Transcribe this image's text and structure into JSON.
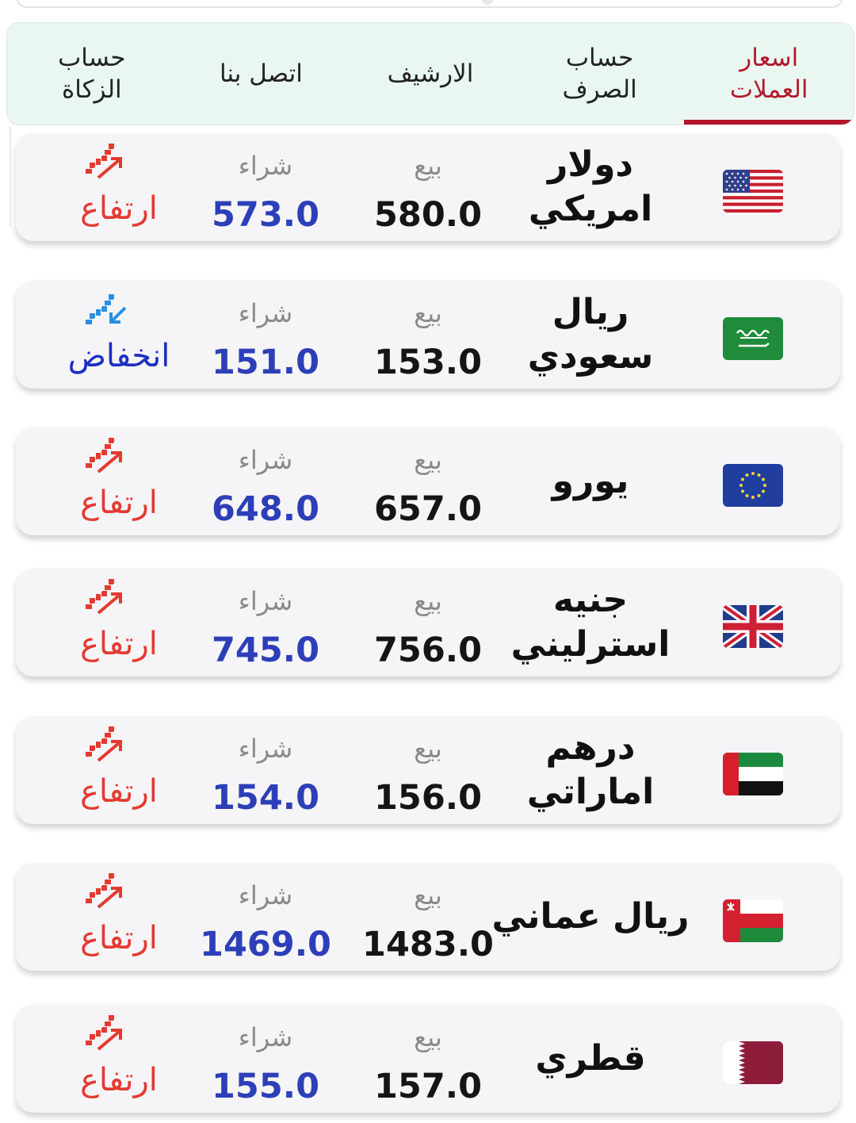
{
  "tabs": [
    {
      "label": "اسعار\nالعملات",
      "active": true
    },
    {
      "label": "حساب\nالصرف",
      "active": false
    },
    {
      "label": "الارشيف",
      "active": false
    },
    {
      "label": "اتصل بنا",
      "active": false
    },
    {
      "label": "حساب\nالزكاة",
      "active": false
    }
  ],
  "columns": {
    "sell": "بيع",
    "buy": "شراء"
  },
  "trend_labels": {
    "up": "ارتفاع",
    "down": "انخفاض"
  },
  "colors": {
    "accent": "#b3142a",
    "buy": "#2d3fb8",
    "up": "#e53a30",
    "down": "#1c2fc3",
    "tab_bg": "#eaf7f1"
  },
  "currencies": [
    {
      "name": "دولار\nامريكي",
      "flag": "us-flag-icon",
      "sell": "580.0",
      "buy": "573.0",
      "trend": "up"
    },
    {
      "name": "ريال\nسعودي",
      "flag": "sa-flag-icon",
      "sell": "153.0",
      "buy": "151.0",
      "trend": "down"
    },
    {
      "name": "يورو",
      "flag": "eu-flag-icon",
      "sell": "657.0",
      "buy": "648.0",
      "trend": "up"
    },
    {
      "name": "جنيه\nاسترليني",
      "flag": "gb-flag-icon",
      "sell": "756.0",
      "buy": "745.0",
      "trend": "up"
    },
    {
      "name": "درهم\nاماراتي",
      "flag": "ae-flag-icon",
      "sell": "156.0",
      "buy": "154.0",
      "trend": "up"
    },
    {
      "name": "ريال عماني",
      "flag": "om-flag-icon",
      "sell": "1483.0",
      "buy": "1469.0",
      "trend": "up"
    },
    {
      "name": "قطري",
      "flag": "qa-flag-icon",
      "sell": "157.0",
      "buy": "155.0",
      "trend": "up"
    }
  ]
}
